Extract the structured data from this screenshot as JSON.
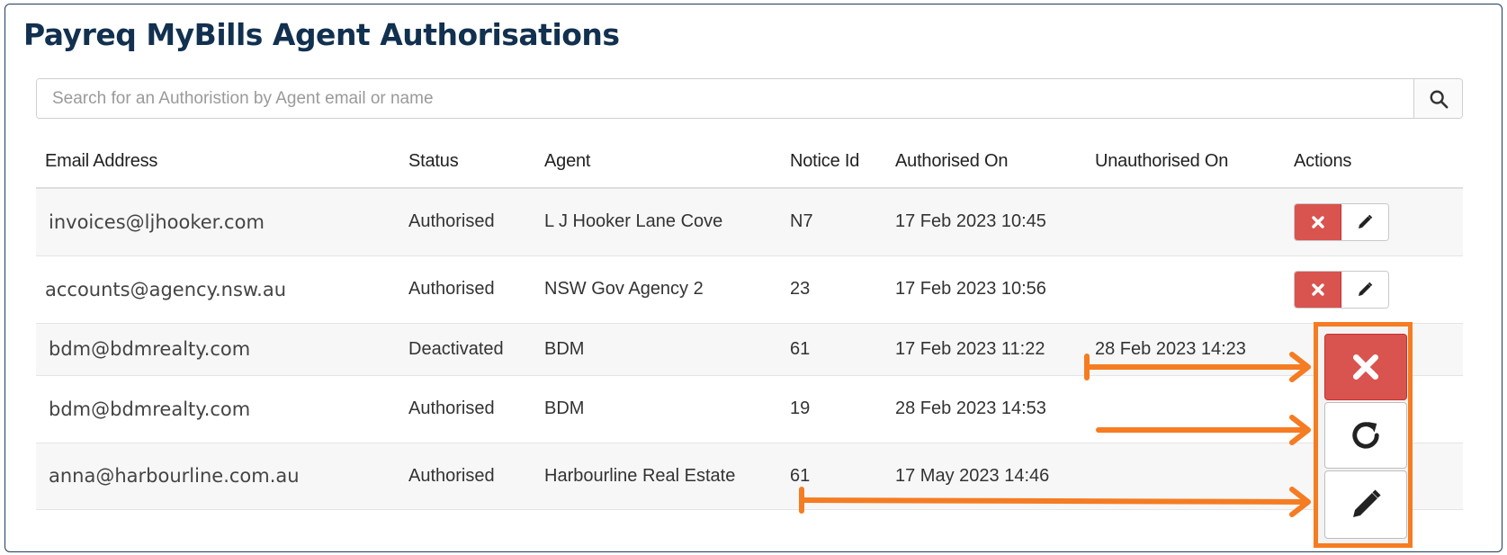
{
  "page": {
    "title": "Payreq MyBills Agent Authorisations"
  },
  "search": {
    "placeholder": "Search for an Authoristion by Agent email or name"
  },
  "table": {
    "headers": {
      "email": "Email Address",
      "status": "Status",
      "agent": "Agent",
      "notice": "Notice Id",
      "authorised": "Authorised On",
      "unauthorised": "Unauthorised On",
      "actions": "Actions"
    },
    "rows": [
      {
        "email": "invoices@ljhooker.com",
        "status": "Authorised",
        "agent": "L J Hooker Lane Cove",
        "notice": "N7",
        "authorised": "17 Feb 2023 10:45",
        "unauthorised": ""
      },
      {
        "email": "accounts@agency.nsw.au",
        "status": "Authorised",
        "agent": "NSW Gov Agency 2",
        "notice": "23",
        "authorised": "17 Feb 2023 10:56",
        "unauthorised": ""
      },
      {
        "email": "bdm@bdmrealty.com",
        "status": "Deactivated",
        "agent": "BDM",
        "notice": "61",
        "authorised": "17 Feb 2023 11:22",
        "unauthorised": "28 Feb 2023 14:23"
      },
      {
        "email": "bdm@bdmrealty.com",
        "status": "Authorised",
        "agent": "BDM",
        "notice": "19",
        "authorised": "28 Feb 2023 14:53",
        "unauthorised": ""
      },
      {
        "email": "anna@harbourline.com.au",
        "status": "Authorised",
        "agent": "Harbourline Real Estate",
        "notice": "61",
        "authorised": "17 May 2023 14:46",
        "unauthorised": ""
      }
    ]
  },
  "icons": {
    "search": "search-icon",
    "deactivate": "close-icon",
    "edit": "pencil-icon",
    "restore": "refresh-icon"
  },
  "colors": {
    "title": "#12304f",
    "danger": "#d9534f",
    "highlight": "#f57c22",
    "border": "#1f3b5a"
  }
}
